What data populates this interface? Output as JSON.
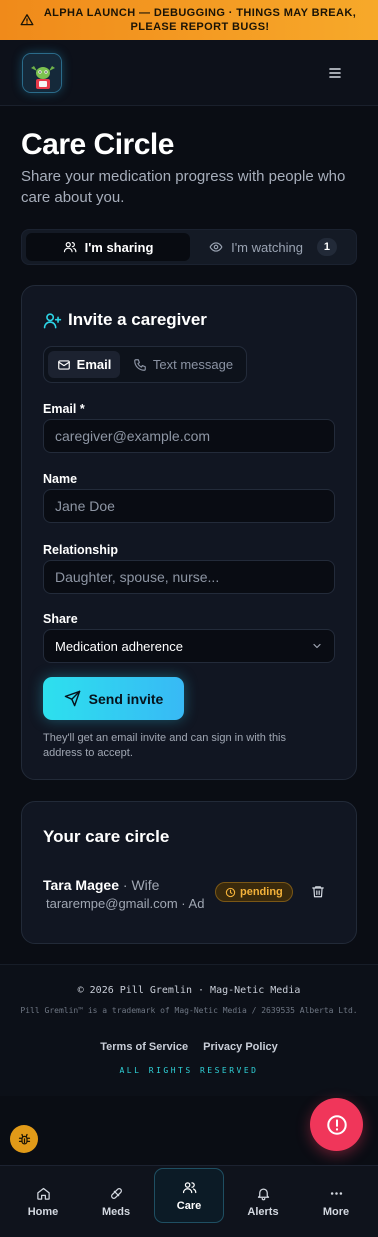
{
  "banner": {
    "text": "ALPHA LAUNCH — DEBUGGING · THINGS MAY BREAK, PLEASE REPORT BUGS!",
    "icon": "warning-icon",
    "color": "#f39a20"
  },
  "header": {
    "logo": "gremlin-logo",
    "menu_icon": "hamburger-menu-icon"
  },
  "page": {
    "title": "Care Circle",
    "subtitle": "Share your medication progress with people who care about you."
  },
  "tabs": [
    {
      "label": "I'm sharing",
      "icon": "users-icon",
      "active": true
    },
    {
      "label": "I'm watching",
      "icon": "eye-icon",
      "count": "1",
      "active": false
    }
  ],
  "invite": {
    "title": "Invite a caregiver",
    "methods": [
      {
        "label": "Email",
        "icon": "mail-icon",
        "active": true
      },
      {
        "label": "Text message",
        "icon": "phone-icon",
        "active": false
      }
    ],
    "email_label": "Email *",
    "email_placeholder": "caregiver@example.com",
    "name_label": "Name",
    "name_placeholder": "Jane Doe",
    "relationship_label": "Relationship",
    "relationship_placeholder": "Daughter, spouse, nurse...",
    "share_label": "Share",
    "share_value": "Medication adherence",
    "send_label": "Send invite",
    "hint": "They'll get an email invite and can sign in with this address to accept."
  },
  "circle": {
    "title": "Your care circle",
    "members": [
      {
        "name": "Tara Magee",
        "relationship": "Wife",
        "contact": "tararempe@gmail.com · Ad",
        "status": "pending"
      }
    ]
  },
  "footer": {
    "copyright": "© 2026 Pill Gremlin · Mag-Netic Media",
    "trademark": "Pill Gremlin™ is a trademark of Mag-Netic Media / 2639535 Alberta Ltd.",
    "terms": "Terms of Service",
    "privacy": "Privacy Policy",
    "rights": "ALL RIGHTS RESERVED"
  },
  "nav": [
    {
      "label": "Home",
      "icon": "home-icon",
      "active": false
    },
    {
      "label": "Meds",
      "icon": "pill-icon",
      "active": false
    },
    {
      "label": "Care",
      "icon": "users-icon",
      "active": true
    },
    {
      "label": "Alerts",
      "icon": "bell-icon",
      "active": false
    },
    {
      "label": "More",
      "icon": "more-dots-icon",
      "active": false
    }
  ],
  "colors": {
    "accent": "#2dd4e6",
    "pending": "#f4b23a",
    "alert_fab": "#f0365a",
    "bug_fab": "#e19a18"
  }
}
